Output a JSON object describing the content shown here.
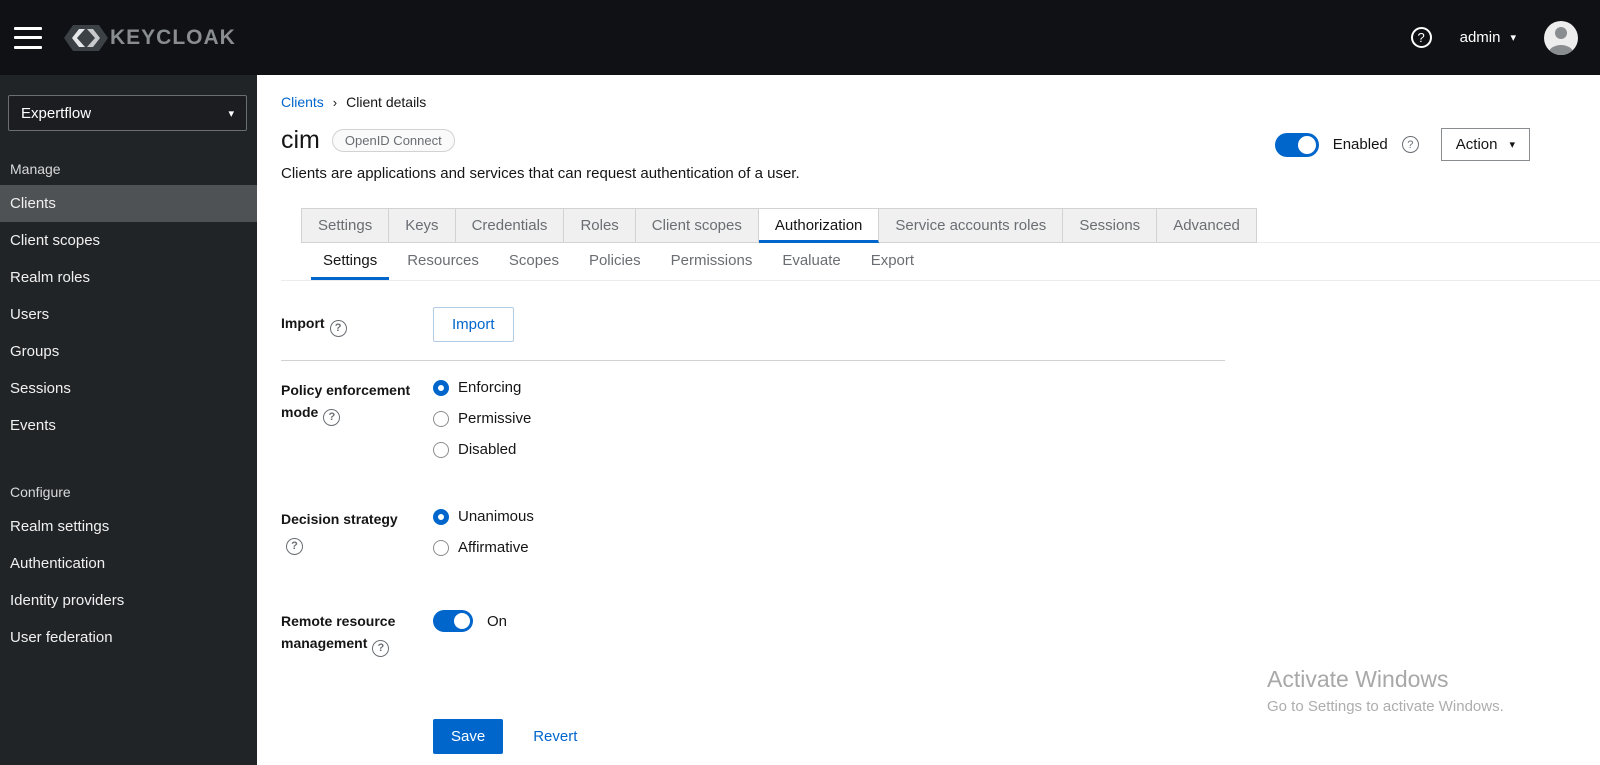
{
  "icons": {
    "question": "?",
    "caret": "▾",
    "breadcrumb_sep": "›"
  },
  "topbar": {
    "brand": "KEYCLOAK",
    "user_label": "admin"
  },
  "sidebar": {
    "realm_selector": "Expertflow",
    "manage": {
      "label": "Manage",
      "items": [
        "Clients",
        "Client scopes",
        "Realm roles",
        "Users",
        "Groups",
        "Sessions",
        "Events"
      ]
    },
    "configure": {
      "label": "Configure",
      "items": [
        "Realm settings",
        "Authentication",
        "Identity providers",
        "User federation"
      ]
    },
    "selected_item": "Clients"
  },
  "breadcrumb": {
    "items": [
      "Clients",
      "Client details"
    ]
  },
  "header": {
    "client_name": "cim",
    "protocol_badge": "OpenID Connect",
    "description": "Clients are applications and services that can request authentication of a user.",
    "enabled_label": "Enabled",
    "enabled_state": "on",
    "action_label": "Action"
  },
  "tabs": {
    "items": [
      "Settings",
      "Keys",
      "Credentials",
      "Roles",
      "Client scopes",
      "Authorization",
      "Service accounts roles",
      "Sessions",
      "Advanced"
    ],
    "active": "Authorization"
  },
  "subtabs": {
    "items": [
      "Settings",
      "Resources",
      "Scopes",
      "Policies",
      "Permissions",
      "Evaluate",
      "Export"
    ],
    "active": "Settings"
  },
  "form": {
    "import": {
      "label": "Import",
      "button_label": "Import"
    },
    "policy_enforcement": {
      "label": "Policy enforcement mode",
      "options": [
        "Enforcing",
        "Permissive",
        "Disabled"
      ],
      "selected": "Enforcing"
    },
    "decision_strategy": {
      "label": "Decision strategy",
      "options": [
        "Unanimous",
        "Affirmative"
      ],
      "selected": "Unanimous"
    },
    "remote_resource": {
      "label": "Remote resource management",
      "state_label": "On",
      "state": "on"
    },
    "save_label": "Save",
    "revert_label": "Revert"
  },
  "watermark": {
    "line1": "Activate Windows",
    "line2": "Go to Settings to activate Windows."
  },
  "colors": {
    "accent": "#0066cc",
    "topbar_bg": "#0f1114",
    "sidebar_bg": "#212427",
    "sidebar_selected": "#4f5255"
  }
}
